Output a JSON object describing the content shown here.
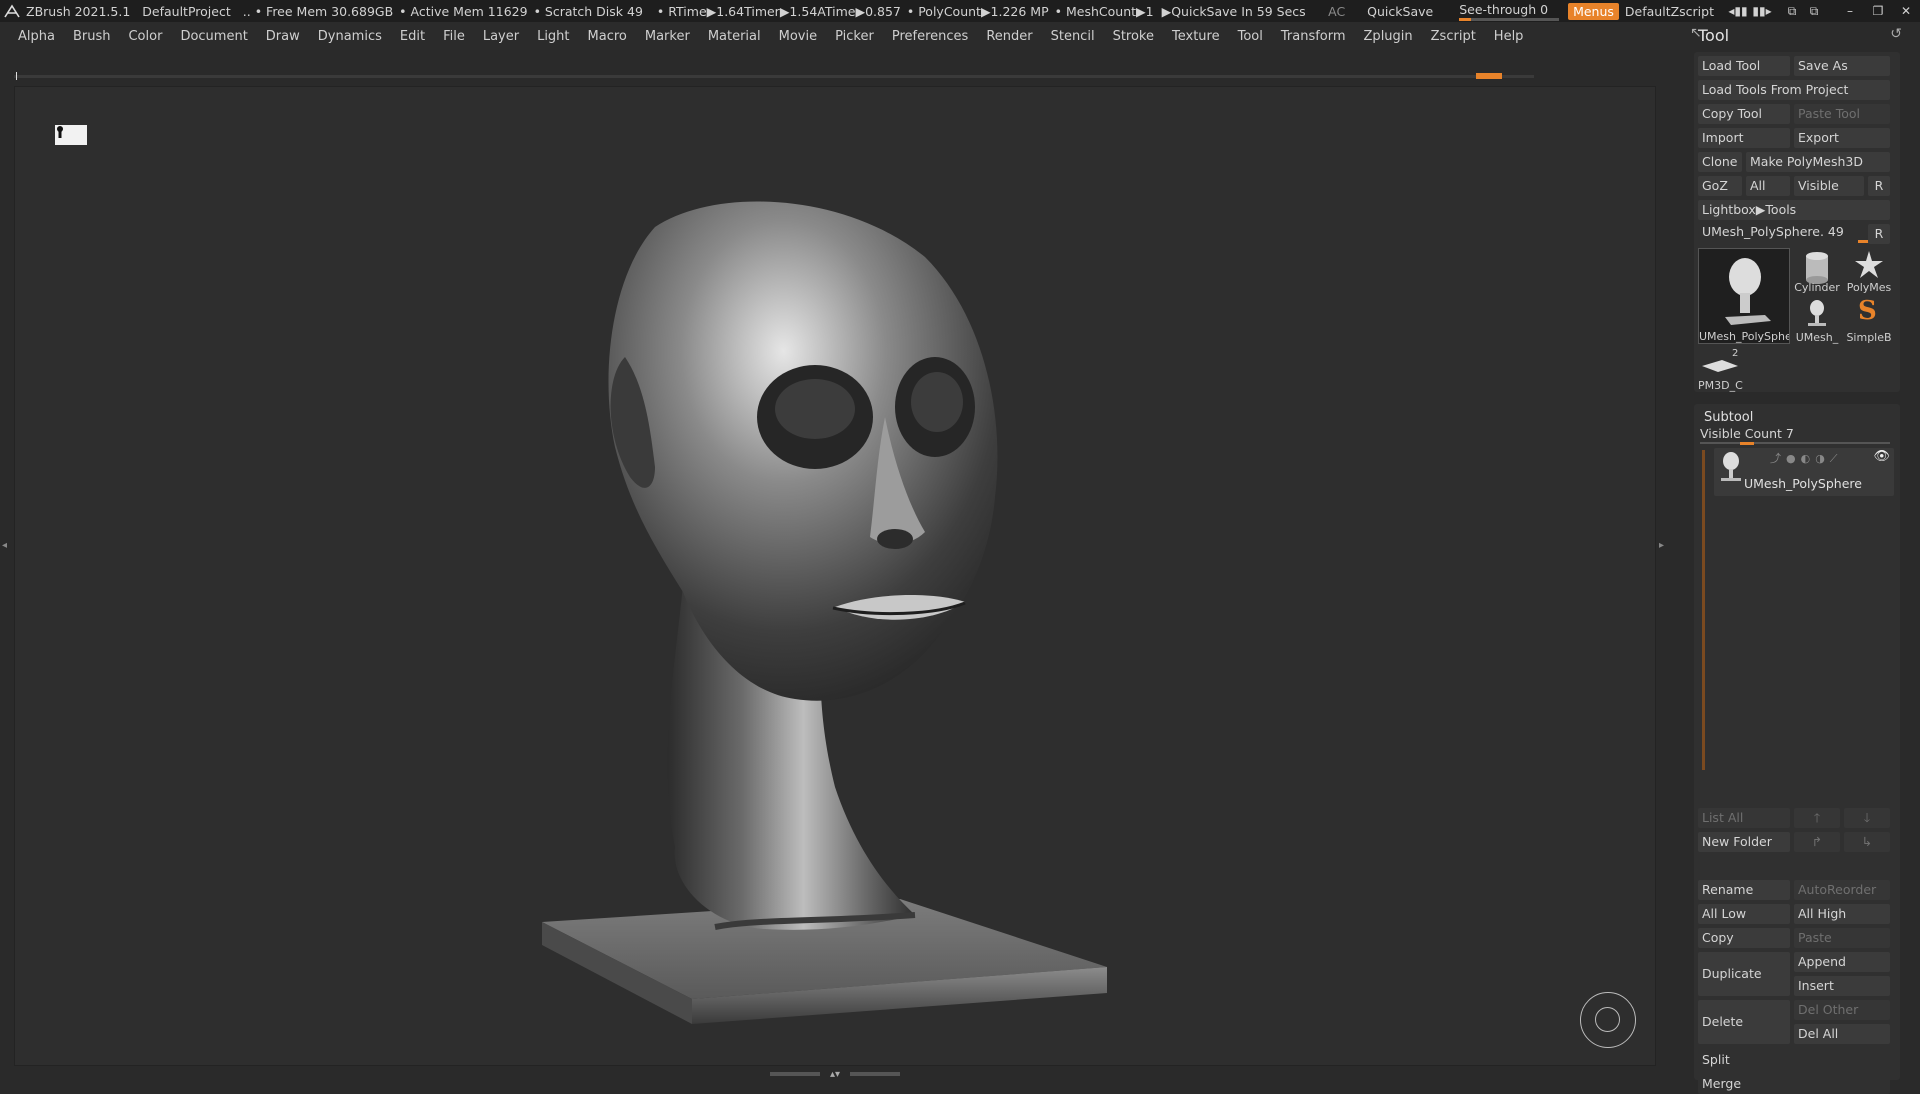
{
  "titlebar": {
    "app": "ZBrush 2021.5.1",
    "project": "DefaultProject",
    "sep": "..",
    "free_mem": "• Free Mem 30.689GB",
    "active_mem": "• Active Mem 11629",
    "scratch": "• Scratch Disk 49",
    "rtime": "• RTime▶1.64",
    "timer": "Timer▶1.54",
    "atime": "ATime▶0.857",
    "polycount": "• PolyCount▶1.226 MP",
    "meshcount": "• MeshCount▶1",
    "quicksave_in": "▶QuickSave In 59 Secs",
    "ac": "AC",
    "quicksave": "QuickSave",
    "see_through": "See-through  0",
    "see_through_value": 0,
    "menus": "Menus",
    "zscript": "DefaultZscript"
  },
  "menubar": [
    "Alpha",
    "Brush",
    "Color",
    "Document",
    "Draw",
    "Dynamics",
    "Edit",
    "File",
    "Layer",
    "Light",
    "Macro",
    "Marker",
    "Material",
    "Movie",
    "Picker",
    "Preferences",
    "Render",
    "Stencil",
    "Stroke",
    "Texture",
    "Tool",
    "Transform",
    "Zplugin",
    "Zscript",
    "Help"
  ],
  "tool_panel": {
    "title": "Tool",
    "load_tool": "Load Tool",
    "save_as": "Save As",
    "load_from_project": "Load Tools From Project",
    "copy_tool": "Copy Tool",
    "paste_tool": "Paste Tool",
    "import": "Import",
    "export": "Export",
    "clone": "Clone",
    "make_polymesh": "Make PolyMesh3D",
    "goz": "GoZ",
    "all": "All",
    "visible": "Visible",
    "r": "R",
    "lightbox": "Lightbox▶Tools",
    "current_tool": "UMesh_PolySphere. 49",
    "thumbs": {
      "main": "UMesh_PolySphe",
      "cylinder": "Cylinder",
      "polymesh": "PolyMes",
      "umesh_small": "UMesh_",
      "simpleb": "SimpleB",
      "pm3d": "PM3D_C",
      "pm3d_count": "2"
    }
  },
  "subtool": {
    "title": "Subtool",
    "visible_count": "Visible Count 7",
    "item_name": "UMesh_PolySphere",
    "list_all": "List All",
    "new_folder": "New Folder",
    "rename": "Rename",
    "autoreorder": "AutoReorder",
    "all_low": "All Low",
    "all_high": "All High",
    "copy": "Copy",
    "paste": "Paste",
    "duplicate": "Duplicate",
    "append": "Append",
    "insert": "Insert",
    "delete": "Delete",
    "del_other": "Del Other",
    "del_all": "Del All",
    "split": "Split",
    "merge": "Merge"
  }
}
